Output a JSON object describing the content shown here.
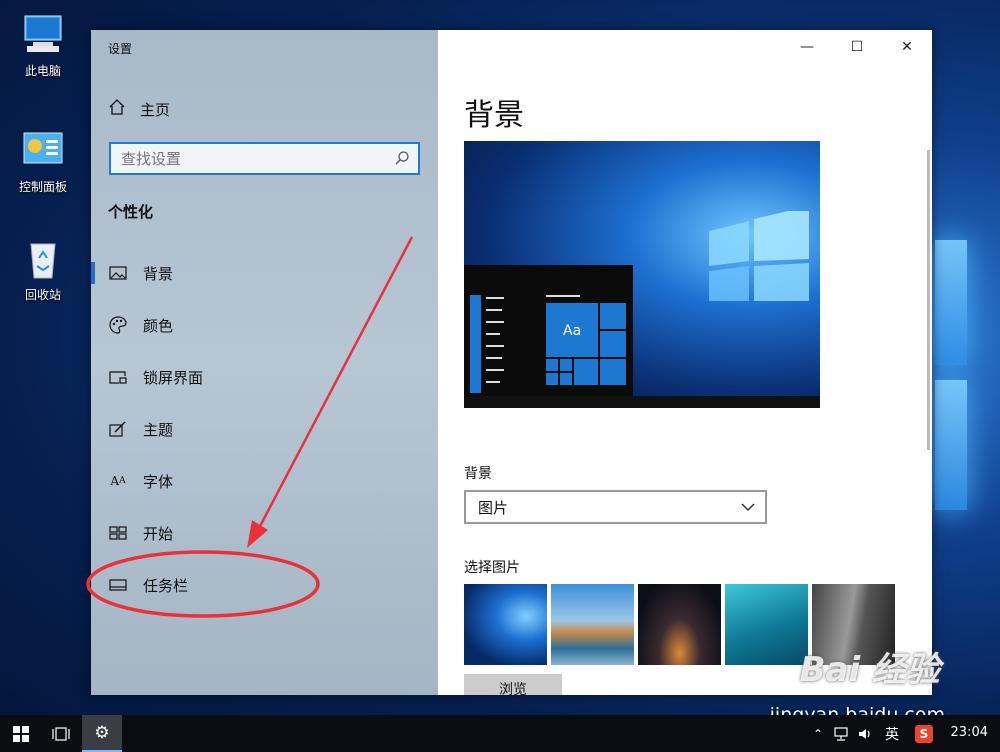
{
  "desktop": {
    "icons": [
      {
        "label": "此电脑",
        "icon": "computer-icon"
      },
      {
        "label": "控制面板",
        "icon": "control-panel-icon"
      },
      {
        "label": "回收站",
        "icon": "recycle-bin-icon"
      }
    ]
  },
  "window": {
    "app_title": "设置",
    "controls": {
      "minimize": "—",
      "maximize": "☐",
      "close": "✕"
    }
  },
  "sidebar": {
    "home_label": "主页",
    "search_placeholder": "查找设置",
    "section_title": "个性化",
    "items": [
      {
        "label": "背景",
        "icon": "picture-icon",
        "active": true
      },
      {
        "label": "颜色",
        "icon": "palette-icon",
        "active": false
      },
      {
        "label": "锁屏界面",
        "icon": "lock-screen-icon",
        "active": false
      },
      {
        "label": "主题",
        "icon": "theme-icon",
        "active": false
      },
      {
        "label": "字体",
        "icon": "font-icon",
        "active": false
      },
      {
        "label": "开始",
        "icon": "start-icon",
        "active": false
      },
      {
        "label": "任务栏",
        "icon": "taskbar-icon",
        "active": false
      }
    ]
  },
  "main": {
    "title": "背景",
    "background_label": "背景",
    "background_value": "图片",
    "choose_picture_label": "选择图片",
    "browse_button": "浏览",
    "preview_tile_text": "Aa"
  },
  "taskbar": {
    "ime_label": "英",
    "time": "23:04"
  },
  "watermark": {
    "logo_text": "Bai 经验",
    "url": "jingyan.baidu.com"
  },
  "colors": {
    "accent": "#1f6fc8",
    "annotation": "#e8313a",
    "sidebar_bg": "#b0c0ce"
  }
}
